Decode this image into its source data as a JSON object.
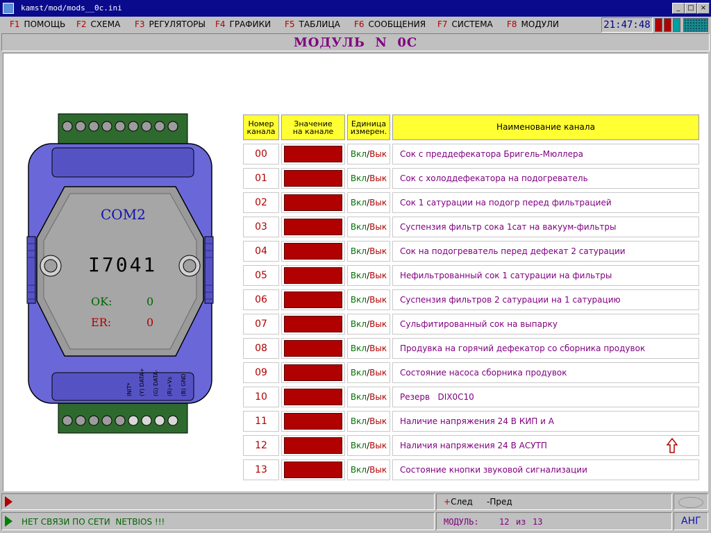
{
  "window": {
    "title": "kamst/mod/mods__0c.ini",
    "buttons": [
      "_",
      "□",
      "×"
    ]
  },
  "menu": [
    {
      "key": "F1",
      "label": "ПОМОЩЬ"
    },
    {
      "key": "F2",
      "label": "СХЕМА"
    },
    {
      "key": "F3",
      "label": "РЕГУЛЯТОРЫ"
    },
    {
      "key": "F4",
      "label": "ГРАФИКИ"
    },
    {
      "key": "F5",
      "label": "ТАБЛИЦА"
    },
    {
      "key": "F6",
      "label": "СООБЩЕНИЯ"
    },
    {
      "key": "F7",
      "label": "СИСТЕМА"
    },
    {
      "key": "F8",
      "label": "МОДУЛИ"
    }
  ],
  "clock": "21:47:48",
  "colors": {
    "accent_purple": "#800080",
    "value_red": "#b00000",
    "header_yellow": "#ffff33",
    "device_blue": "#6a68d8"
  },
  "module_title": "МОДУЛЬ  N  0C",
  "device": {
    "port": "COM2",
    "model": "I7041",
    "ok_label": "OK:",
    "ok_value": "0",
    "er_label": "ER:",
    "er_value": "0",
    "pins": [
      "INIT*",
      "(Y) DATA+",
      "(G) DATA-",
      "(R)+Vs",
      "(B) GND"
    ]
  },
  "table": {
    "headers": {
      "num": [
        "Номер",
        "канала"
      ],
      "value": [
        "Значение",
        "на канале"
      ],
      "unit": [
        "Единица",
        "измерен."
      ],
      "name": "Наименование канала"
    },
    "rows": [
      {
        "num": "00",
        "on": "Вкл",
        "off": "Вык",
        "name": "Сок с преддефекатора Бригель-Мюллера"
      },
      {
        "num": "01",
        "on": "Вкл",
        "off": "Вык",
        "name": "Сок с холоддефекатора на подогреватель"
      },
      {
        "num": "02",
        "on": "Вкл",
        "off": "Вык",
        "name": "Сок 1 сатурации на подогр перед фильтрацией"
      },
      {
        "num": "03",
        "on": "Вкл",
        "off": "Вык",
        "name": "Суспензия фильтр сока 1сат на вакуум-фильтры"
      },
      {
        "num": "04",
        "on": "Вкл",
        "off": "Вык",
        "name": "Сок на подогреватель перед дефекат 2 сатурации"
      },
      {
        "num": "05",
        "on": "Вкл",
        "off": "Вык",
        "name": "Нефильтрованный сок 1 сатурации на фильтры"
      },
      {
        "num": "06",
        "on": "Вкл",
        "off": "Вык",
        "name": "Суспензия фильтров 2 сатурации на 1 сатурацию"
      },
      {
        "num": "07",
        "on": "Вкл",
        "off": "Вык",
        "name": "Сульфитированный сок на выпарку"
      },
      {
        "num": "08",
        "on": "Вкл",
        "off": "Вык",
        "name": "Продувка на горячий дефекатор со сборника продувок"
      },
      {
        "num": "09",
        "on": "Вкл",
        "off": "Вык",
        "name": "Состояние насоса сборника продувок"
      },
      {
        "num": "10",
        "on": "Вкл",
        "off": "Вык",
        "name": "Резерв   DIX0C10"
      },
      {
        "num": "11",
        "on": "Вкл",
        "off": "Вык",
        "name": "Наличие напряжения 24 В КИП и А"
      },
      {
        "num": "12",
        "on": "Вкл",
        "off": "Вык",
        "name": "Наличия напряжения 24 В АСУТП"
      },
      {
        "num": "13",
        "on": "Вкл",
        "off": "Вык",
        "name": "Состояние кнопки звуковой сигнализации"
      }
    ]
  },
  "status": {
    "next": "+След",
    "prev": "-Пред",
    "message": "НЕТ СВЯЗИ ПО СЕТИ  NETBIOS !!!",
    "module_label": "МОДУЛЬ:",
    "module_index": "12",
    "module_of": "из",
    "module_total": "13",
    "lang": "АНГ"
  }
}
